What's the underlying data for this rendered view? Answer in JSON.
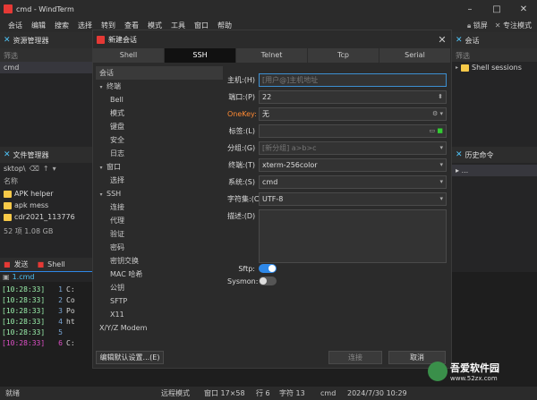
{
  "window": {
    "title": "cmd - WindTerm",
    "minimize": "–",
    "maximize": "□",
    "close": "✕"
  },
  "menu": [
    "会话",
    "编辑",
    "搜索",
    "选择",
    "转到",
    "查看",
    "模式",
    "工具",
    "窗口",
    "帮助"
  ],
  "menu_right": {
    "lock": "锁屏",
    "mode": "专注模式"
  },
  "left_panel": {
    "title": "资源管理器",
    "filter": "筛选",
    "item": "cmd"
  },
  "file_panel": {
    "title": "文件管理器",
    "path": "sktop\\",
    "col": "名称",
    "items": [
      "APK helper",
      "apk mess",
      "cdr2021_113776"
    ],
    "footer": "52 项 1.08 GB"
  },
  "bottom_tabs": {
    "send": "发送",
    "shell": "Shell",
    "doc": "1.cmd"
  },
  "terminal": [
    {
      "ts": "[10:28:33]",
      "ln": "1",
      "t": "C:"
    },
    {
      "ts": "[10:28:33]",
      "ln": "2",
      "t": "Co"
    },
    {
      "ts": "[10:28:33]",
      "ln": "3",
      "t": "Po"
    },
    {
      "ts": "[10:28:33]",
      "ln": "4",
      "t": "ht"
    },
    {
      "ts": "[10:28:33]",
      "ln": "5",
      "t": ""
    },
    {
      "ts": "[10:28:33]",
      "ln": "6",
      "t": "C:"
    }
  ],
  "right_panel": {
    "title": "会话",
    "filter": "筛选",
    "item": "Shell sessions",
    "history": "历史命令",
    "hist_item": "..."
  },
  "dialog": {
    "title": "新建会话",
    "tabs": [
      "Shell",
      "SSH",
      "Telnet",
      "Tcp",
      "Serial"
    ],
    "tree": [
      {
        "label": "会话",
        "level": 0,
        "arrow": "",
        "sel": true
      },
      {
        "label": "终端",
        "level": 0,
        "arrow": "▾"
      },
      {
        "label": "Bell",
        "level": 2
      },
      {
        "label": "模式",
        "level": 2
      },
      {
        "label": "键盘",
        "level": 2
      },
      {
        "label": "安全",
        "level": 2
      },
      {
        "label": "日志",
        "level": 2
      },
      {
        "label": "窗口",
        "level": 0,
        "arrow": "▾"
      },
      {
        "label": "选择",
        "level": 2
      },
      {
        "label": "SSH",
        "level": 0,
        "arrow": "▾"
      },
      {
        "label": "连接",
        "level": 2
      },
      {
        "label": "代理",
        "level": 2
      },
      {
        "label": "验证",
        "level": 2
      },
      {
        "label": "密码",
        "level": 2
      },
      {
        "label": "密钥交换",
        "level": 2
      },
      {
        "label": "MAC 哈希",
        "level": 2
      },
      {
        "label": "公钥",
        "level": 2
      },
      {
        "label": "SFTP",
        "level": 2
      },
      {
        "label": "X11",
        "level": 2
      },
      {
        "label": "X/Y/Z Modem",
        "level": 1
      }
    ],
    "fields": {
      "host_label": "主机:(H)",
      "host_ph": "[用户@]主机地址",
      "port_label": "端口:(P)",
      "port": "22",
      "onekey_label": "OneKey:",
      "onekey": "无",
      "tag_label": "标签:(L)",
      "group_label": "分组:(G)",
      "group_ph": "[新分组] a>b>c",
      "term_label": "终端:(T)",
      "term": "xterm-256color",
      "sys_label": "系统:(S)",
      "sys": "cmd",
      "charset_label": "字符集:(C)",
      "charset": "UTF-8",
      "desc_label": "描述:(D)",
      "sftp_label": "Sftp:",
      "sysmon_label": "Sysmon:"
    },
    "buttons": {
      "defaults": "编辑默认设置...(E)",
      "connect": "连接",
      "cancel": "取消"
    }
  },
  "status": {
    "ready": "就绪",
    "mode": "远程模式",
    "win": "窗口 17×58",
    "row": "行 6",
    "char": "字符 13",
    "sys": "cmd",
    "date": "2024/7/30 10:29"
  },
  "watermark": {
    "name": "吾爱软件园",
    "url": "www.52zx.com"
  }
}
